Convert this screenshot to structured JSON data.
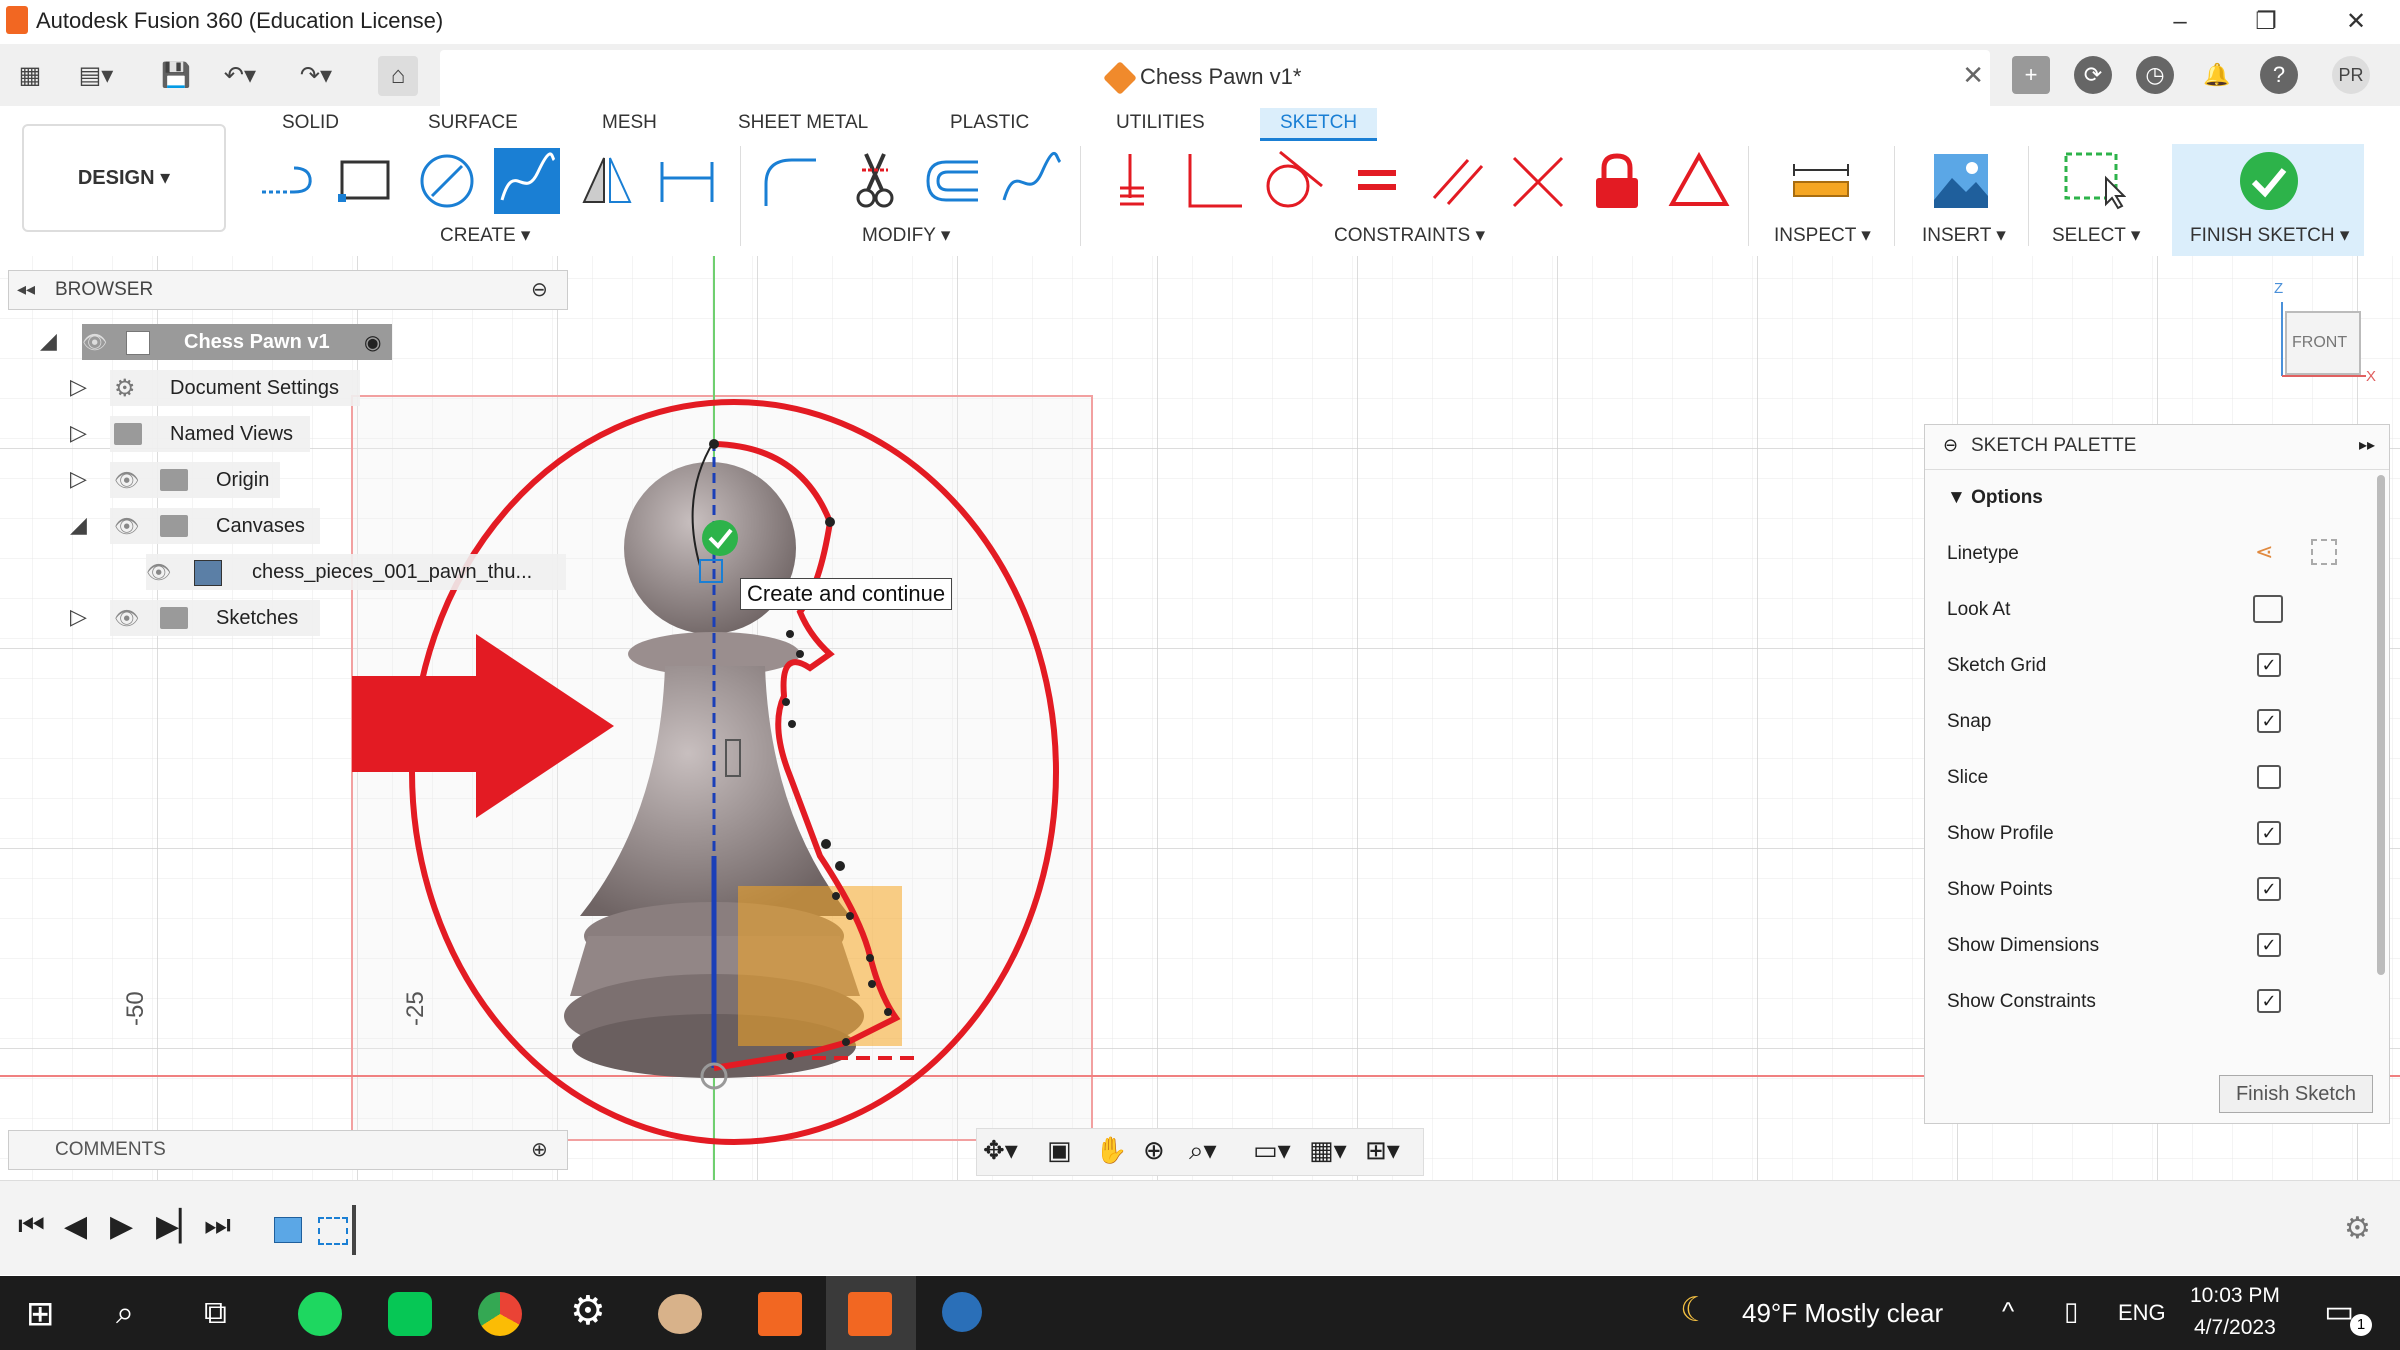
{
  "window": {
    "title": "Autodesk Fusion 360 (Education License)",
    "minimize": "–",
    "restore": "❐",
    "close": "✕"
  },
  "document": {
    "tab_title": "Chess Pawn v1*",
    "close": "✕",
    "user_initials": "PR"
  },
  "workspace_tabs": [
    "SOLID",
    "SURFACE",
    "MESH",
    "SHEET METAL",
    "PLASTIC",
    "UTILITIES",
    "SKETCH"
  ],
  "active_tab": "SKETCH",
  "design_button": "DESIGN ▾",
  "toolbar_groups": {
    "create": "CREATE ▾",
    "modify": "MODIFY ▾",
    "constraints": "CONSTRAINTS ▾",
    "inspect": "INSPECT ▾",
    "insert": "INSERT ▾",
    "select": "SELECT ▾",
    "finish_sketch": "FINISH SKETCH ▾"
  },
  "browser": {
    "header": "BROWSER",
    "root": "Chess Pawn v1",
    "items": [
      {
        "label": "Document Settings",
        "icon": "gear-icon"
      },
      {
        "label": "Named Views",
        "icon": "folder-icon"
      },
      {
        "label": "Origin",
        "icon": "folder-icon"
      },
      {
        "label": "Canvases",
        "icon": "folder-icon"
      },
      {
        "label": "chess_pieces_001_pawn_thu...",
        "icon": "image-icon"
      },
      {
        "label": "Sketches",
        "icon": "folder-icon"
      }
    ]
  },
  "comments": {
    "header": "COMMENTS"
  },
  "tooltip": "Create and continue",
  "viewcube": {
    "face": "FRONT",
    "z": "Z",
    "x": "X"
  },
  "axis_labels": [
    "-50",
    "-25"
  ],
  "sketch_palette": {
    "header": "SKETCH PALETTE",
    "section": "Options",
    "rows": [
      {
        "label": "Linetype",
        "control": "linetype-icons"
      },
      {
        "label": "Look At",
        "control": "look-at-icon"
      },
      {
        "label": "Sketch Grid",
        "checked": true
      },
      {
        "label": "Snap",
        "checked": true
      },
      {
        "label": "Slice",
        "checked": false
      },
      {
        "label": "Show Profile",
        "checked": true
      },
      {
        "label": "Show Points",
        "checked": true
      },
      {
        "label": "Show Dimensions",
        "checked": true
      },
      {
        "label": "Show Constraints",
        "checked": true
      }
    ],
    "finish_button": "Finish Sketch"
  },
  "taskbar": {
    "weather": "49°F  Mostly clear",
    "language": "ENG",
    "time": "10:03 PM",
    "date": "4/7/2023",
    "notification_count": "1"
  },
  "colors": {
    "accent": "#1a7fd4",
    "annotation_red": "#e31b23",
    "finish_green": "#2db34a",
    "pawn": "#8c7f7f"
  }
}
